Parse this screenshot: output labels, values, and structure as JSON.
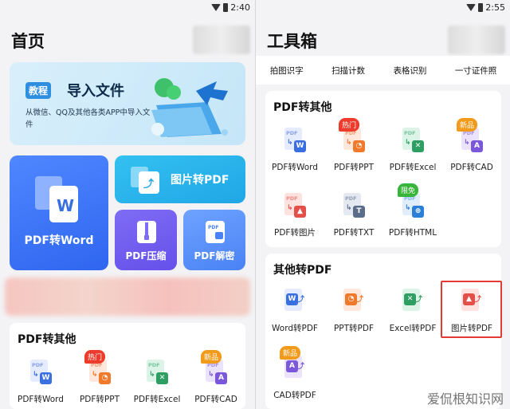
{
  "left": {
    "status_time": "2:40",
    "title": "首页",
    "import": {
      "badge": "教程",
      "title": "导入文件",
      "desc": "从微信、QQ及其他各类APP中导入文件"
    },
    "tiles": {
      "word": "PDF转Word",
      "img": "图片转PDF",
      "zip": "PDF压缩",
      "dec": "PDF解密"
    },
    "section_title": "PDF转其他",
    "tools": [
      {
        "name": "PDF转Word",
        "badge": ""
      },
      {
        "name": "PDF转PPT",
        "badge": "热门"
      },
      {
        "name": "PDF转Excel",
        "badge": ""
      },
      {
        "name": "PDF转CAD",
        "badge": "新品"
      }
    ]
  },
  "right": {
    "status_time": "2:55",
    "title": "工具箱",
    "top_tools": [
      "拍图识字",
      "扫描计数",
      "表格识别",
      "一寸证件照"
    ],
    "section1_title": "PDF转其他",
    "section1_tools": [
      {
        "name": "PDF转Word",
        "badge": ""
      },
      {
        "name": "PDF转PPT",
        "badge": "热门"
      },
      {
        "name": "PDF转Excel",
        "badge": ""
      },
      {
        "name": "PDF转CAD",
        "badge": "新品"
      },
      {
        "name": "PDF转图片",
        "badge": ""
      },
      {
        "name": "PDF转TXT",
        "badge": ""
      },
      {
        "name": "PDF转HTML",
        "badge": "限免"
      }
    ],
    "section2_title": "其他转PDF",
    "section2_tools": [
      {
        "name": "Word转PDF",
        "badge": ""
      },
      {
        "name": "PPT转PDF",
        "badge": ""
      },
      {
        "name": "Excel转PDF",
        "badge": ""
      },
      {
        "name": "图片转PDF",
        "badge": ""
      },
      {
        "name": "CAD转PDF",
        "badge": "新品"
      }
    ]
  },
  "watermark": "爱侃根知识网",
  "icon_colors": {
    "word": "#3a6fe0",
    "ppt": "#f07a2c",
    "excel": "#2e9e63",
    "cad": "#7b57d9",
    "img": "#e3504a",
    "txt": "#5b6b8a",
    "html": "#2a7fd8"
  }
}
